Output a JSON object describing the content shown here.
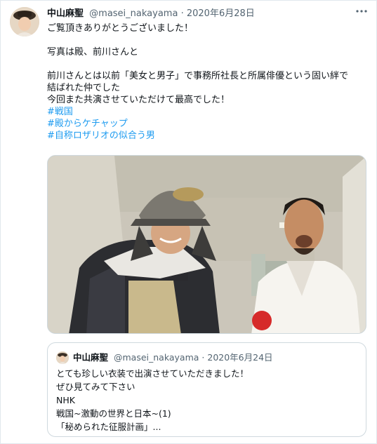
{
  "tweet": {
    "display_name": "中山麻聖",
    "handle": "@masei_nakayama",
    "separator": "·",
    "date": "2020年6月28日",
    "more_icon": "more-horizontal-icon",
    "lines": [
      "ご覧頂きありがとうございました！",
      "",
      "写真は殿、前川さんと",
      "",
      "前川さんとは以前「美女と男子」で事務所社長と所属俳優という固い絆で",
      "結ばれた仲でした",
      "今回また共演させていただけて最高でした！"
    ],
    "hashtags": [
      "#戦国",
      "#殿からケチャップ",
      "#自称ロザリオの似合う男"
    ],
    "colors": {
      "link": "#1d9bf0",
      "secondary": "#536471",
      "border": "#cfd9de"
    }
  },
  "quoted": {
    "display_name": "中山麻聖",
    "handle": "@masei_nakayama",
    "separator": "·",
    "date": "2020年6月24日",
    "lines": [
      "とても珍しい衣装で出演させていただきました！",
      "ぜひ見てみて下さい",
      "NHK",
      "戦国~激動の世界と日本~(1)",
      "「秘められた征服計画」..."
    ]
  }
}
